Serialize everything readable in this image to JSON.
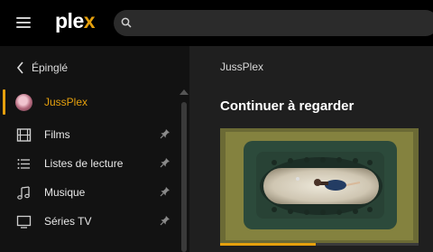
{
  "app": {
    "logo_main": "ple",
    "logo_accent": "x"
  },
  "search": {
    "placeholder": ""
  },
  "sidebar": {
    "back_label": "Épinglé",
    "items": [
      {
        "label": "JussPlex",
        "icon": "avatar",
        "active": true
      },
      {
        "label": "Films",
        "icon": "film-icon",
        "pinned": true
      },
      {
        "label": "Listes de lecture",
        "icon": "playlist-icon",
        "pinned": true
      },
      {
        "label": "Musique",
        "icon": "music-icon",
        "pinned": true
      },
      {
        "label": "Séries TV",
        "icon": "tv-icon",
        "pinned": true
      }
    ]
  },
  "main": {
    "breadcrumb": "JussPlex",
    "section_title": "Continuer à regarder",
    "cards": [
      {
        "progress": 0.48
      }
    ]
  },
  "colors": {
    "accent": "#e5a00d",
    "topbar": "#000000",
    "sidebar": "#121212",
    "main": "#1f1f1f"
  }
}
